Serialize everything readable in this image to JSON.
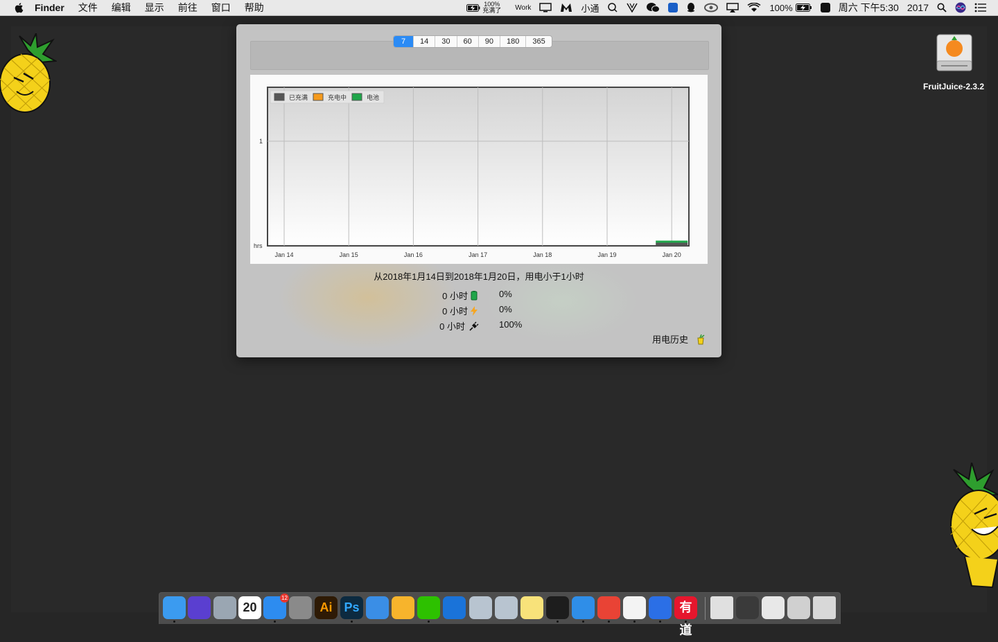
{
  "menubar": {
    "app_name": "Finder",
    "menus": [
      "文件",
      "编辑",
      "显示",
      "前往",
      "窗口",
      "帮助"
    ],
    "battery_top": "100%",
    "battery_bottom": "充满了",
    "work_label": "Work",
    "xiaotong_label": "小通",
    "battery_percent": "100%",
    "datetime": "周六 下午5:30",
    "year": "2017"
  },
  "desktop": {
    "drive_label": "FruitJuice-2.3.2"
  },
  "popup": {
    "ranges": [
      "7",
      "14",
      "30",
      "60",
      "90",
      "180",
      "365"
    ],
    "active_range": "7",
    "summary": "从2018年1月14日到2018年1月20日，用电小于1小时",
    "stats": [
      {
        "hours": "0 小时",
        "icon": "battery-icon",
        "percent": "0%"
      },
      {
        "hours": "0 小时",
        "icon": "lightning-icon",
        "percent": "0%"
      },
      {
        "hours": "0 小时",
        "icon": "plug-icon",
        "percent": "100%"
      }
    ],
    "history_label": "用电历史"
  },
  "chart_data": {
    "type": "bar",
    "categories": [
      "Jan 14",
      "Jan 15",
      "Jan 16",
      "Jan 17",
      "Jan 18",
      "Jan 19",
      "Jan 20"
    ],
    "series": [
      {
        "name": "已充满",
        "color": "#555555",
        "values": [
          0,
          0,
          0,
          0,
          0,
          0,
          0.03
        ]
      },
      {
        "name": "充电中",
        "color": "#f59a1d",
        "values": [
          0,
          0,
          0,
          0,
          0,
          0,
          0
        ]
      },
      {
        "name": "电池",
        "color": "#1fa64a",
        "values": [
          0,
          0,
          0,
          0,
          0,
          0,
          0.02
        ]
      }
    ],
    "ylabel": "hrs",
    "ytick_labels": [
      "1"
    ],
    "ylim": [
      0,
      2
    ],
    "legend": "top-left",
    "grid": true
  },
  "dock": {
    "items": [
      {
        "name": "finder",
        "color": "#3b9bf0",
        "running": true
      },
      {
        "name": "siri",
        "color": "#5a3fd0",
        "running": false
      },
      {
        "name": "launchpad",
        "color": "#9aa6b2",
        "running": false
      },
      {
        "name": "calendar",
        "color": "#ffffff",
        "running": false,
        "label": "20"
      },
      {
        "name": "app-store",
        "color": "#2d8cf0",
        "running": true,
        "badge": "12"
      },
      {
        "name": "system-preferences",
        "color": "#8a8a8a",
        "running": false
      },
      {
        "name": "illustrator",
        "color": "#2e1a05",
        "running": false,
        "label": "Ai"
      },
      {
        "name": "photoshop",
        "color": "#0c2a40",
        "running": true,
        "label": "Ps"
      },
      {
        "name": "safari",
        "color": "#3a8ee6",
        "running": false
      },
      {
        "name": "sketch",
        "color": "#f7b42c",
        "running": false
      },
      {
        "name": "wechat",
        "color": "#2dc100",
        "running": true
      },
      {
        "name": "teamviewer",
        "color": "#1a73d9",
        "running": false
      },
      {
        "name": "xcode-tool-1",
        "color": "#b8c4d0",
        "running": false
      },
      {
        "name": "xcode-tool-2",
        "color": "#b8c4d0",
        "running": false
      },
      {
        "name": "notes",
        "color": "#f8e27a",
        "running": false
      },
      {
        "name": "qq",
        "color": "#1d1d1d",
        "running": true
      },
      {
        "name": "icloud",
        "color": "#2f8ee8",
        "running": true
      },
      {
        "name": "chrome",
        "color": "#e94335",
        "running": true
      },
      {
        "name": "textedit",
        "color": "#f3f3f3",
        "running": true
      },
      {
        "name": "baidu-netdisk",
        "color": "#2b6fe6",
        "running": true
      },
      {
        "name": "youdao",
        "color": "#e6162d",
        "running": true,
        "label": "有道"
      },
      {
        "name": "document",
        "color": "#e0e0e0",
        "running": false
      },
      {
        "name": "screenshot-1",
        "color": "#3a3a3a",
        "running": false
      },
      {
        "name": "screenshot-2",
        "color": "#e8e8e8",
        "running": false
      },
      {
        "name": "screenshot-3",
        "color": "#d0d0d0",
        "running": false
      },
      {
        "name": "trash",
        "color": "#d8d8d8",
        "running": false
      }
    ]
  }
}
